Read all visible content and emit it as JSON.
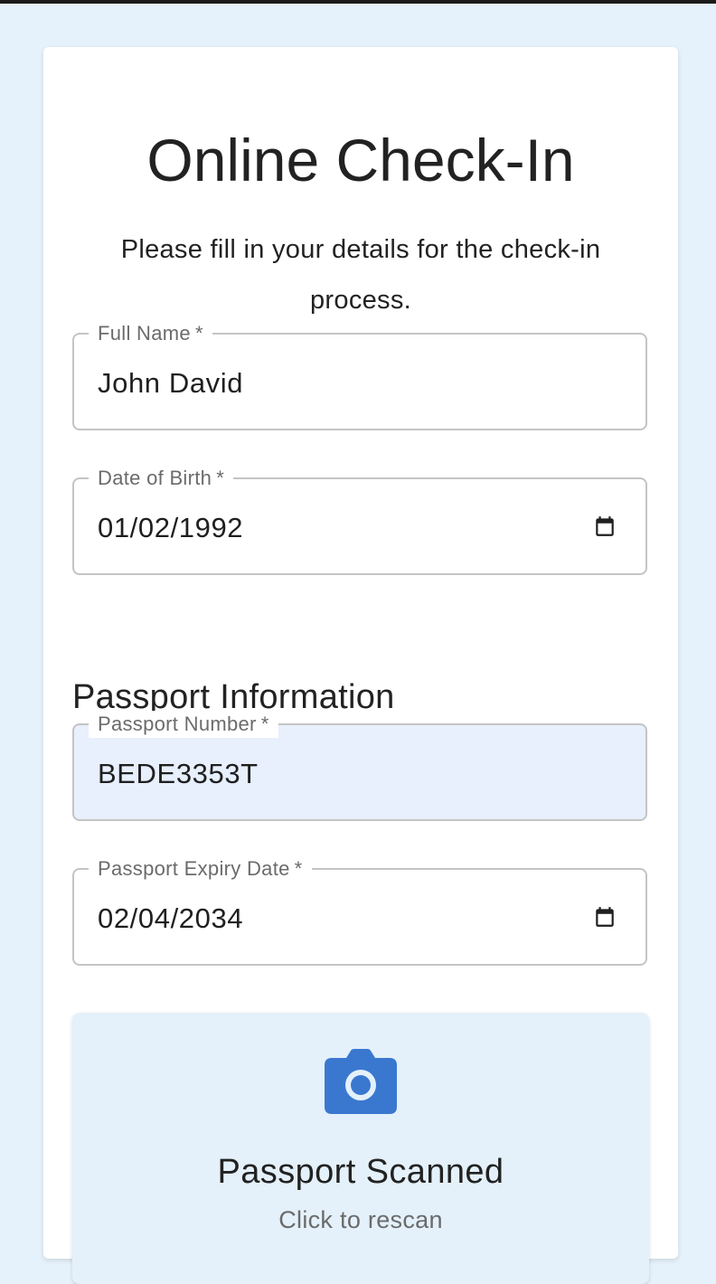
{
  "page": {
    "title": "Online Check-In",
    "subtitle": "Please fill in your details for the check-in process."
  },
  "form": {
    "full_name": {
      "label": "Full Name",
      "required_mark": "*",
      "value": "John David"
    },
    "date_of_birth": {
      "label": "Date of Birth",
      "required_mark": "*",
      "value": "01/02/1992",
      "icon": "calendar-icon"
    }
  },
  "passport": {
    "heading": "Passport Information",
    "number": {
      "label": "Passport Number",
      "required_mark": "*",
      "value": "BEDE3353T"
    },
    "expiry": {
      "label": "Passport Expiry Date",
      "required_mark": "*",
      "value": "02/04/2034",
      "icon": "calendar-icon"
    }
  },
  "scan": {
    "icon": "camera-icon",
    "title": "Passport Scanned",
    "subtitle": "Click to rescan"
  },
  "colors": {
    "background": "#e6f2fb",
    "card": "#ffffff",
    "autofill": "#e8effd",
    "accent": "#3a78d0",
    "scan_box": "#e4f1fb"
  }
}
